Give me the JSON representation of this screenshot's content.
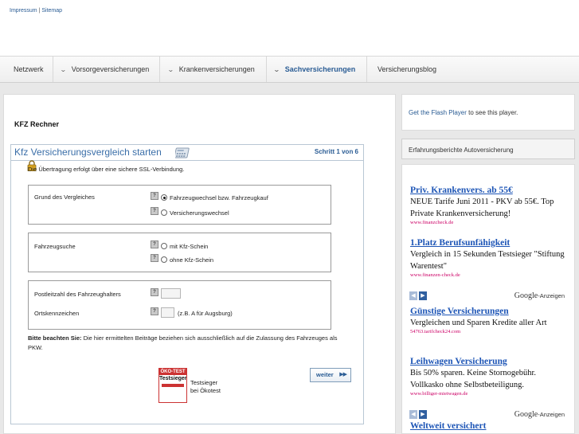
{
  "top_links": {
    "impressum": "Impressum",
    "separator": "|",
    "sitemap": "Sitemap"
  },
  "nav": {
    "items": [
      {
        "label": "Netzwerk",
        "dropdown": false,
        "active": false
      },
      {
        "label": "Vorsorgeversicherungen",
        "dropdown": true,
        "active": false
      },
      {
        "label": "Krankenversicherungen",
        "dropdown": true,
        "active": false
      },
      {
        "label": "Sachversicherungen",
        "dropdown": true,
        "active": true
      },
      {
        "label": "Versicherungsblog",
        "dropdown": false,
        "active": false
      }
    ]
  },
  "main": {
    "title": "KFZ Rechner",
    "calculator": {
      "title": "Kfz Versicherungsvergleich starten",
      "step": "Schritt 1 von 6",
      "ssl_text": "Die Übertragung erfolgt über eine sichere SSL-Verbindung.",
      "grund": {
        "label": "Grund des Vergleiches",
        "options": [
          {
            "label": "Fahrzeugwechsel bzw. Fahrzeugkauf",
            "selected": true
          },
          {
            "label": "Versicherungswechsel",
            "selected": false
          }
        ]
      },
      "suche": {
        "label": "Fahrzeugsuche",
        "options": [
          {
            "label": "mit Kfz-Schein",
            "selected": false
          },
          {
            "label": "ohne Kfz-Schein",
            "selected": false
          }
        ]
      },
      "plz_label": "Postleitzahl des Fahrzeughalters",
      "plz_value": "",
      "kennzeichen_label": "Ortskennzeichen",
      "kennzeichen_value": "",
      "kennzeichen_hint": "(z.B. A für Augsburg)",
      "note_bold": "Bitte beachten Sie:",
      "note_text": " Die hier ermittelten Beiträge beziehen sich ausschließlich auf die Zulassung des Fahrzeuges als PKW.",
      "badge": {
        "brand": "ÖKO-TEST",
        "big": "Testsieger"
      },
      "badge_caption_1": "Testsieger",
      "badge_caption_2": "bei Ökotest",
      "next_button": "weiter",
      "next_arrows": "▶▶"
    }
  },
  "sidebar": {
    "flash_link": "Get the Flash Player",
    "flash_text": " to see this player.",
    "erfahrungsberichte": "Erfahrungsberichte Autoversicherung",
    "ads_block_1": [
      {
        "title": "Priv. Krankenvers. ab 55€",
        "text": "NEUE Tarife Juni 2011 - PKV ab 55€. Top Private Krankenversicherung!",
        "url": "www.finanzcheck.de"
      },
      {
        "title": "1.Platz Berufsunfähigkeit",
        "text": "Vergleich in 15 Sekunden Testsieger \"Stiftung Warentest\"",
        "url": "www.finanzen-check.de"
      }
    ],
    "ads_block_2": [
      {
        "title": "Günstige Versicherungen",
        "text": "Vergleichen und Sparen Kredite aller Art",
        "url": "54763.tarifcheck24.com"
      },
      {
        "title": "Leihwagen Versicherung",
        "text": "Bis 50% sparen. Keine Stornogebühr. Vollkasko ohne Selbstbeteiligung.",
        "url": "www.billiger-mietwagen.de"
      }
    ],
    "ads_block_3_title": "Weltweit versichert",
    "google_word": "Google",
    "anzeigen": "-Anzeigen",
    "prev_arrow": "◀",
    "next_arrow": "▶"
  }
}
